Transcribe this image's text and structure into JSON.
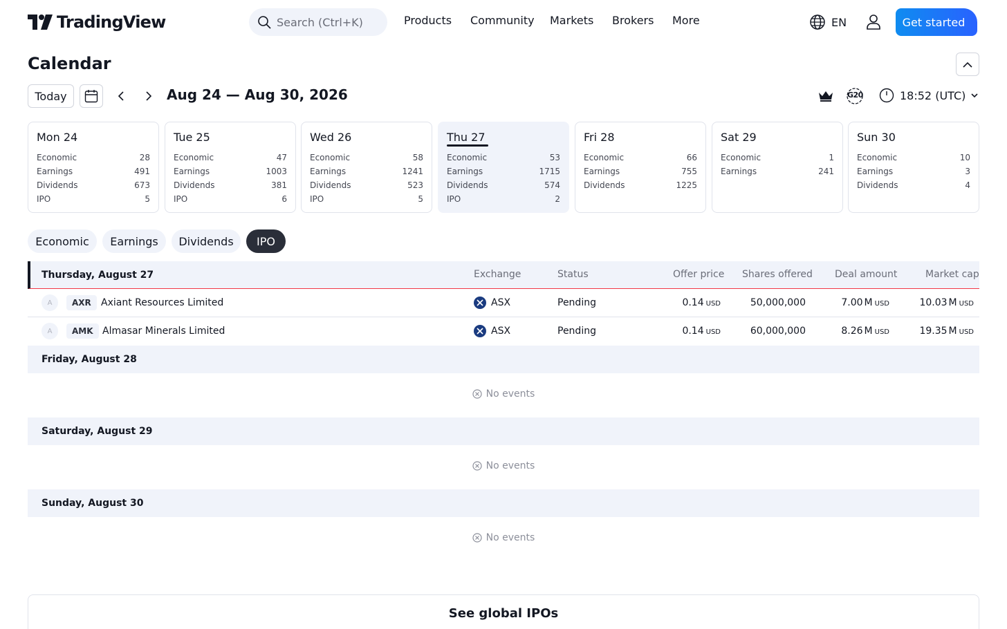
{
  "header": {
    "logo_text": "TradingView",
    "search_placeholder": "Search (Ctrl+K)",
    "nav": [
      "Products",
      "Community",
      "Markets",
      "Brokers",
      "More"
    ],
    "language": "EN",
    "cta_label": "Get started"
  },
  "page": {
    "title": "Calendar",
    "today_label": "Today",
    "date_range": "Aug 24 — Aug 30, 2026",
    "g20_label": "G20",
    "time_label": "18:52 (UTC)"
  },
  "days": [
    {
      "name": "Mon 24",
      "stats": [
        {
          "label": "Economic",
          "value": "28"
        },
        {
          "label": "Earnings",
          "value": "491"
        },
        {
          "label": "Dividends",
          "value": "673"
        },
        {
          "label": "IPO",
          "value": "5"
        }
      ]
    },
    {
      "name": "Tue 25",
      "stats": [
        {
          "label": "Economic",
          "value": "47"
        },
        {
          "label": "Earnings",
          "value": "1003"
        },
        {
          "label": "Dividends",
          "value": "381"
        },
        {
          "label": "IPO",
          "value": "6"
        }
      ]
    },
    {
      "name": "Wed 26",
      "stats": [
        {
          "label": "Economic",
          "value": "58"
        },
        {
          "label": "Earnings",
          "value": "1241"
        },
        {
          "label": "Dividends",
          "value": "523"
        },
        {
          "label": "IPO",
          "value": "5"
        }
      ]
    },
    {
      "name": "Thu 27",
      "stats": [
        {
          "label": "Economic",
          "value": "53"
        },
        {
          "label": "Earnings",
          "value": "1715"
        },
        {
          "label": "Dividends",
          "value": "574"
        },
        {
          "label": "IPO",
          "value": "2"
        }
      ]
    },
    {
      "name": "Fri 28",
      "stats": [
        {
          "label": "Economic",
          "value": "66"
        },
        {
          "label": "Earnings",
          "value": "755"
        },
        {
          "label": "Dividends",
          "value": "1225"
        }
      ]
    },
    {
      "name": "Sat 29",
      "stats": [
        {
          "label": "Economic",
          "value": "1"
        },
        {
          "label": "Earnings",
          "value": "241"
        }
      ]
    },
    {
      "name": "Sun 30",
      "stats": [
        {
          "label": "Economic",
          "value": "10"
        },
        {
          "label": "Earnings",
          "value": "3"
        },
        {
          "label": "Dividends",
          "value": "4"
        }
      ]
    }
  ],
  "filters": [
    "Economic",
    "Earnings",
    "Dividends",
    "IPO"
  ],
  "table": {
    "columns": {
      "exchange": "Exchange",
      "status": "Status",
      "offer_price": "Offer price",
      "shares_offered": "Shares offered",
      "deal_amount": "Deal amount",
      "market_cap": "Market cap"
    },
    "groups": [
      {
        "title": "Thursday, August 27",
        "rows": [
          {
            "avatar": "A",
            "ticker": "AXR",
            "name": "Axiant Resources Limited",
            "exchange": "ASX",
            "status": "Pending",
            "offer_price": "0.14",
            "offer_unit": "USD",
            "shares": "50,000,000",
            "deal": "7.00",
            "deal_suffix": "M",
            "deal_unit": "USD",
            "mcap": "10.03",
            "mcap_suffix": "M",
            "mcap_unit": "USD"
          },
          {
            "avatar": "A",
            "ticker": "AMK",
            "name": "Almasar Minerals Limited",
            "exchange": "ASX",
            "status": "Pending",
            "offer_price": "0.14",
            "offer_unit": "USD",
            "shares": "60,000,000",
            "deal": "8.26",
            "deal_suffix": "M",
            "deal_unit": "USD",
            "mcap": "19.35",
            "mcap_suffix": "M",
            "mcap_unit": "USD"
          }
        ]
      },
      {
        "title": "Friday, August 28",
        "empty": "No events"
      },
      {
        "title": "Saturday, August 29",
        "empty": "No events"
      },
      {
        "title": "Sunday, August 30",
        "empty": "No events"
      }
    ]
  },
  "footer": {
    "global_ipos": "See global IPOs"
  },
  "colors": {
    "accent": "#2962ff",
    "brand_gradient_start": "#0f8cf0",
    "separator_red": "#f23645",
    "exchange_logo": "#1a3b80"
  }
}
